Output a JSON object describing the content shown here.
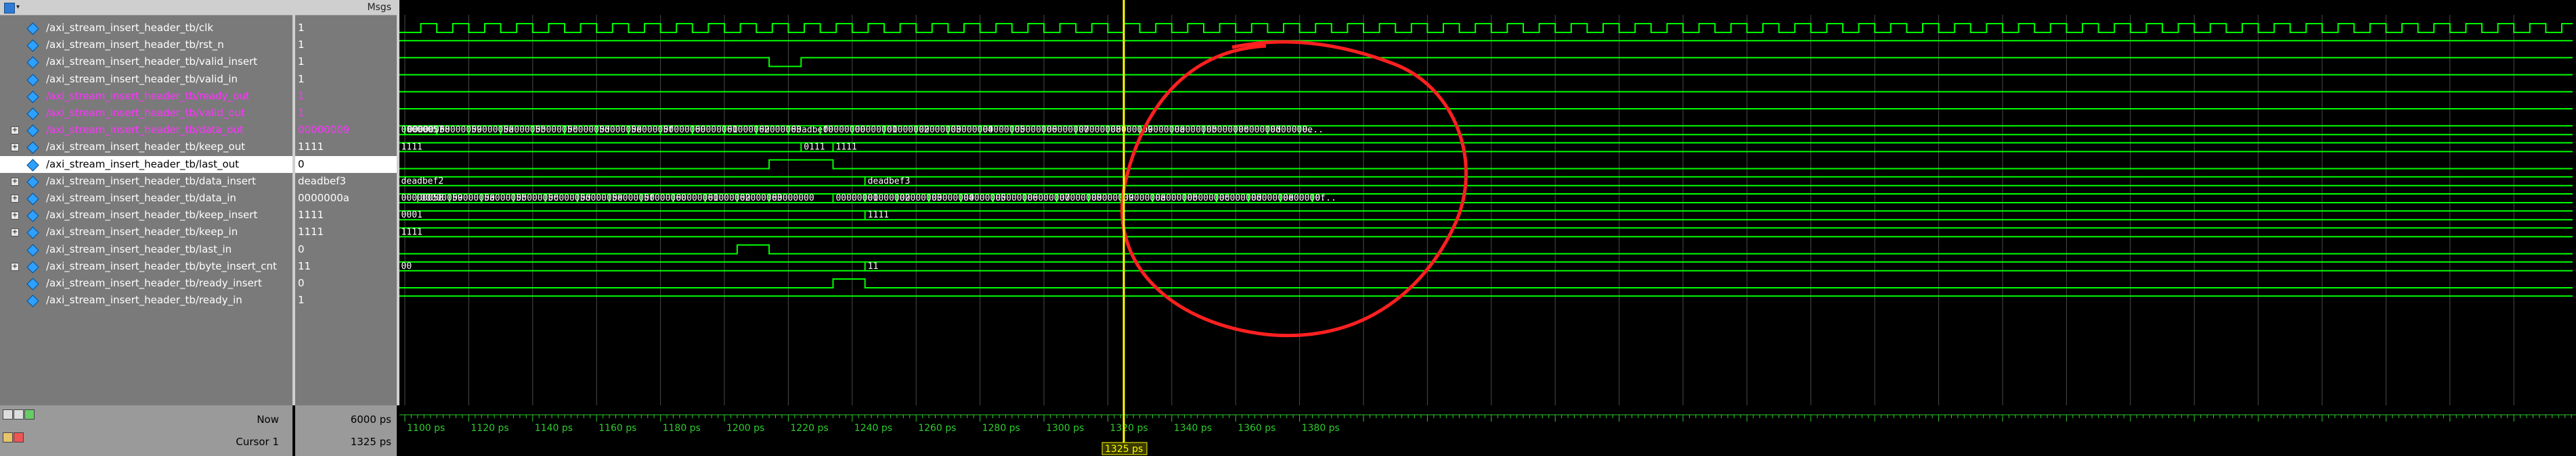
{
  "header": {
    "msgs_label": "Msgs"
  },
  "signals": [
    {
      "name": "/axi_stream_insert_header_tb/clk",
      "value": "1",
      "expandable": false,
      "color": "white"
    },
    {
      "name": "/axi_stream_insert_header_tb/rst_n",
      "value": "1",
      "expandable": false,
      "color": "white"
    },
    {
      "name": "/axi_stream_insert_header_tb/valid_insert",
      "value": "1",
      "expandable": false,
      "color": "white"
    },
    {
      "name": "/axi_stream_insert_header_tb/valid_in",
      "value": "1",
      "expandable": false,
      "color": "white"
    },
    {
      "name": "/axi_stream_insert_header_tb/ready_out",
      "value": "1",
      "expandable": false,
      "color": "magenta"
    },
    {
      "name": "/axi_stream_insert_header_tb/valid_out",
      "value": "1",
      "expandable": false,
      "color": "magenta"
    },
    {
      "name": "/axi_stream_insert_header_tb/data_out",
      "value": "00000009",
      "expandable": true,
      "color": "magenta"
    },
    {
      "name": "/axi_stream_insert_header_tb/keep_out",
      "value": "1111",
      "expandable": true,
      "color": "white"
    },
    {
      "name": "/axi_stream_insert_header_tb/last_out",
      "value": "0",
      "expandable": false,
      "color": "white",
      "selected": true
    },
    {
      "name": "/axi_stream_insert_header_tb/data_insert",
      "value": "deadbef3",
      "expandable": true,
      "color": "white"
    },
    {
      "name": "/axi_stream_insert_header_tb/data_in",
      "value": "0000000a",
      "expandable": true,
      "color": "white"
    },
    {
      "name": "/axi_stream_insert_header_tb/keep_insert",
      "value": "1111",
      "expandable": true,
      "color": "white"
    },
    {
      "name": "/axi_stream_insert_header_tb/keep_in",
      "value": "1111",
      "expandable": true,
      "color": "white"
    },
    {
      "name": "/axi_stream_insert_header_tb/last_in",
      "value": "0",
      "expandable": false,
      "color": "white"
    },
    {
      "name": "/axi_stream_insert_header_tb/byte_insert_cnt",
      "value": "11",
      "expandable": true,
      "color": "white"
    },
    {
      "name": "/axi_stream_insert_header_tb/ready_insert",
      "value": "0",
      "expandable": false,
      "color": "white"
    },
    {
      "name": "/axi_stream_insert_header_tb/ready_in",
      "value": "1",
      "expandable": false,
      "color": "white"
    }
  ],
  "waves": {
    "data_out": [
      "00000057",
      "00000058",
      "00000059",
      "0000005a",
      "0000005b",
      "0000005c",
      "0000005d",
      "0000005e",
      "0000005f",
      "00000060",
      "00000061",
      "00000062",
      "00000063",
      "00adbef0",
      "00000000",
      "00000001",
      "00000002",
      "00000003",
      "00000004",
      "00000005",
      "00000006",
      "00000007",
      "00000008",
      "00000009",
      "0000000a",
      "0000000b",
      "0000000c",
      "0000000d",
      "0000000e",
      "0..."
    ],
    "keep_out": [
      "1111",
      "0111",
      "1111"
    ],
    "data_insert": [
      "deadbef2",
      "deadbef3"
    ],
    "data_in": [
      "00000058",
      "00000059",
      "0000005a",
      "0000005b",
      "0000005c",
      "0000005d",
      "0000005e",
      "0000005f",
      "00000060",
      "00000061",
      "00000062",
      "00000063",
      "00000000",
      "00000001",
      "00000002",
      "00000003",
      "00000004",
      "00000005",
      "00000006",
      "00000007",
      "00000008",
      "00000009",
      "0000000a",
      "0000000b",
      "0000000c",
      "0000000d",
      "0000000e",
      "0000000f",
      "0..."
    ],
    "keep_insert": [
      "0001",
      "1111"
    ],
    "keep_in": [
      "1111"
    ],
    "byte_insert_cnt": [
      "00",
      "11"
    ]
  },
  "timeline": {
    "ticks": [
      "1100 ps",
      "1120 ps",
      "1140 ps",
      "1160 ps",
      "1180 ps",
      "1200 ps",
      "1220 ps",
      "1240 ps",
      "1260 ps",
      "1280 ps",
      "1300 ps",
      "1320 ps",
      "1340 ps",
      "1360 ps",
      "1380 ps"
    ],
    "cursor_label": "1325 ps"
  },
  "footer": {
    "now_label": "Now",
    "now_value": "6000 ps",
    "cursor_name": "Cursor 1",
    "cursor_value": "1325 ps"
  },
  "colors": {
    "wave": "#00ff00",
    "grid": "#4a4a4a",
    "cursor": "#ffff00",
    "annotation": "#ff2020",
    "magenta_text": "#ff33ff",
    "timeline_text": "#2ecc2e"
  }
}
